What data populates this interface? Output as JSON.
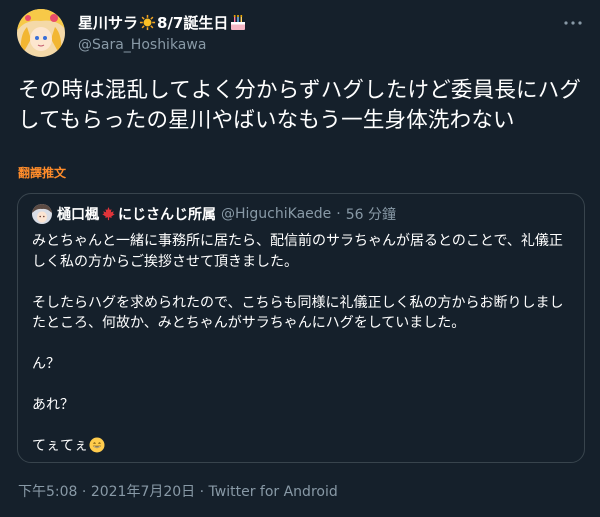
{
  "author": {
    "name": "星川サラ",
    "sun_emoji": "☀️",
    "birthday_text": "8/7誕生日",
    "cake_emoji": "🎂",
    "handle": "@Sara_Hoshikawa"
  },
  "more_icon": "more-dots-icon",
  "tweet": {
    "text": "その時は混乱してよく分からずハグしたけど委員長にハグしてもらったの星川やばいなもう一生身体洗わない",
    "translate_label": "翻譯推文"
  },
  "quoted": {
    "name": "樋口楓",
    "flag_emoji": "🍁",
    "affiliation": "にじさんじ所属",
    "handle": "@HiguchiKaede",
    "separator": "·",
    "time_ago": "56 分鐘",
    "paragraphs": [
      "みとちゃんと一緒に事務所に居たら、配信前のサラちゃんが居るとのことで、礼儀正しく私の方からご挨拶させて頂きました。",
      "そしたらハグを求められたので、こちらも同様に礼儀正しく私の方からお断りしましたところ、何故か、みとちゃんがサラちゃんにハグをしていました。",
      "ん？",
      "あれ？",
      "てぇてぇ"
    ],
    "end_emoji": "grinning-face-icon"
  },
  "footer": {
    "time": "下午5:08",
    "separator": "·",
    "date": "2021年7月20日",
    "source": "Twitter for Android"
  },
  "colors": {
    "background": "#15202b",
    "secondary_text": "#8899a6",
    "translate_link": "#ff8c2a",
    "border": "#38444d"
  }
}
